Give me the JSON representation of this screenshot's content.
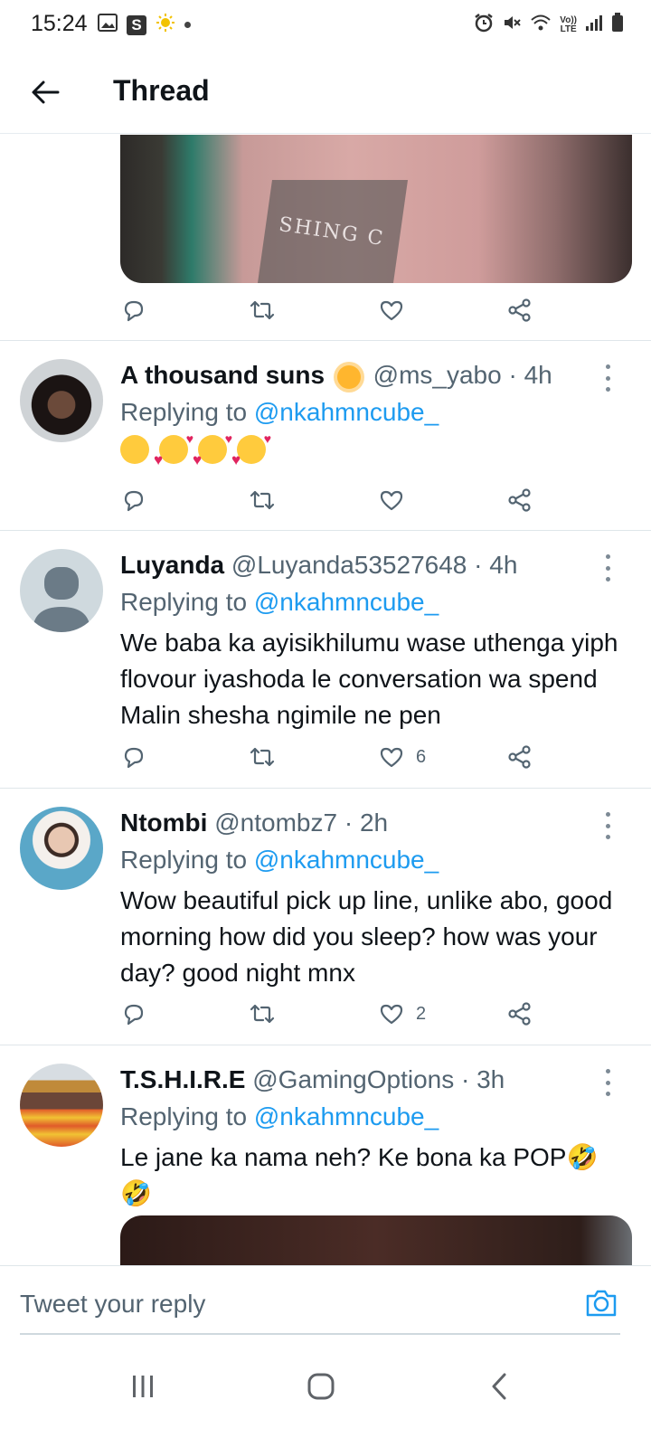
{
  "status_bar": {
    "time": "15:24",
    "notif_s": "S",
    "lte_top": "Vo))",
    "lte_bottom": "LTE"
  },
  "header": {
    "title": "Thread"
  },
  "top_media": {
    "caption": "SHING C"
  },
  "tweets": [
    {
      "name": "A thousand suns",
      "handle": "@ms_yabo",
      "time": "4h",
      "replying_label": "Replying to ",
      "replying_to": "@nkahmncube_",
      "text": "",
      "emojis": [
        "face-with-rolling-eyes",
        "smiling-face-with-hearts",
        "smiling-face-with-hearts",
        "smiling-face-with-hearts"
      ],
      "likes": ""
    },
    {
      "name": "Luyanda",
      "handle": "@Luyanda53527648",
      "time": "4h",
      "replying_label": "Replying to ",
      "replying_to": "@nkahmncube_",
      "text": "We baba ka ayisikhilumu wase uthenga yiph flovour iyashoda le conversation wa spend Malin shesha ngimile ne pen",
      "likes": "6"
    },
    {
      "name": "Ntombi",
      "handle": "@ntombz7",
      "time": "2h",
      "replying_label": "Replying to ",
      "replying_to": "@nkahmncube_",
      "text": "Wow beautiful pick up line, unlike abo, good morning how did you sleep? how was your day? good night mnx",
      "likes": "2"
    },
    {
      "name": "T.S.H.I.R.E",
      "handle": "@GamingOptions",
      "time": "3h",
      "replying_label": "Replying to ",
      "replying_to": "@nkahmncube_",
      "text": "Le jane ka nama neh? Ke bona ka POP🤣 🤣",
      "likes": ""
    }
  ],
  "reply_bar": {
    "placeholder": "Tweet your reply"
  },
  "colors": {
    "link": "#1d9bf0",
    "secondary_text": "#536471",
    "primary_text": "#0f1419"
  },
  "icons": [
    "back-arrow-icon",
    "reply-icon",
    "retweet-icon",
    "like-icon",
    "share-icon",
    "more-icon",
    "camera-icon",
    "recents-icon",
    "home-icon",
    "back-nav-icon"
  ]
}
